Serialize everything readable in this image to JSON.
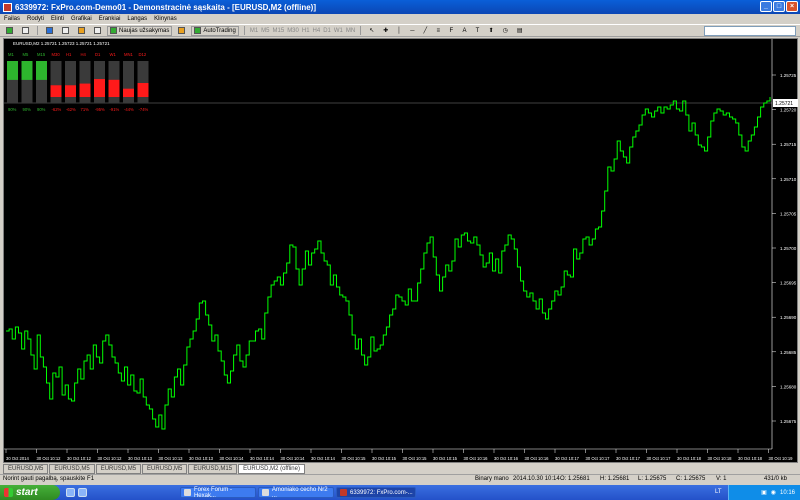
{
  "window": {
    "title": "6339972: FxPro.com-Demo01 - Demonstracinė sąskaita - [EURUSD,M2 (offline)]"
  },
  "menu": [
    "Failas",
    "Rodyti",
    "Elinti",
    "Grafikai",
    "Erankiai",
    "Langas",
    "Klinynas"
  ],
  "toolbar": {
    "new_order_label": "Naujas užsakymas",
    "autotrading_label": "AutoTrading",
    "timeframes": [
      "M1",
      "M5",
      "M15",
      "M30",
      "H1",
      "H4",
      "D1",
      "W1",
      "MN"
    ]
  },
  "chart": {
    "header": "EURUSD,M2  1.25721 1.25723 1.25721 1.25721",
    "symbol": "EURUSD",
    "timeframe": "M2",
    "current_price": "1.25721",
    "bg_color": "#000000",
    "line_color": "#00ff00",
    "price_labels": [
      "1.25725",
      "1.25720",
      "1.25715",
      "1.25710",
      "1.25705",
      "1.25700",
      "1.25695",
      "1.25690",
      "1.25685",
      "1.25680",
      "1.25675"
    ],
    "time_labels": [
      "30 Oct 2014",
      "30 Oct 10:12",
      "30 Oct 10:12",
      "30 Oct 10:12",
      "30 Oct 10:13",
      "30 Oct 10:13",
      "30 Oct 10:13",
      "30 Oct 10:14",
      "30 Oct 10:14",
      "30 Oct 10:14",
      "30 Oct 10:14",
      "30 Oct 10:15",
      "30 Oct 10:15",
      "30 Oct 10:15",
      "30 Oct 10:15",
      "30 Oct 10:16",
      "30 Oct 10:16",
      "30 Oct 10:16",
      "30 Oct 10:17",
      "30 Oct 10:17",
      "30 Oct 10:17",
      "30 Oct 10:17",
      "30 Oct 10:18",
      "30 Oct 10:18",
      "30 Oct 10:18",
      "30 Oct 10:19"
    ]
  },
  "strength_indicator": {
    "timeframes": [
      "M1",
      "M5",
      "M15",
      "M30",
      "H1",
      "H4",
      "D1",
      "W1",
      "MN1",
      "D12"
    ],
    "values": [
      "90%",
      "90%",
      "90%",
      "-62%",
      "-62%",
      "71%",
      "-95%",
      "-91%",
      "-44%",
      "-74%"
    ],
    "levels": [
      0.9,
      0.9,
      0.9,
      -0.62,
      -0.62,
      -0.71,
      -0.95,
      -0.91,
      -0.44,
      -0.74
    ],
    "positive_color": "#2db52d",
    "negative_color": "#ff1a1a"
  },
  "tabs": [
    "EURUSD,M5",
    "EURUSD,M5",
    "EURUSD,M5",
    "EURUSD,M5",
    "EURUSD,M15",
    "EURUSD,M2 (offline)"
  ],
  "active_tab": 5,
  "status": {
    "help": "Norint gauti pagalbą, spauskite F1",
    "profile": "Binary mano",
    "datetime": "2014.10.30 10:14",
    "open": "O: 1.25681",
    "high": "H: 1.25681",
    "low": "L: 1.25675",
    "close": "C: 1.25675",
    "volume": "V: 1",
    "traffic": "431/0 kb"
  },
  "taskbar": {
    "start_label": "start",
    "items": [
      "Forex Forum - Hexak...",
      "Amoniako cecho Nr2 ...",
      "6339972: FxPro.com-..."
    ],
    "active_item": 2,
    "lang": "LT",
    "clock": "10:16"
  }
}
